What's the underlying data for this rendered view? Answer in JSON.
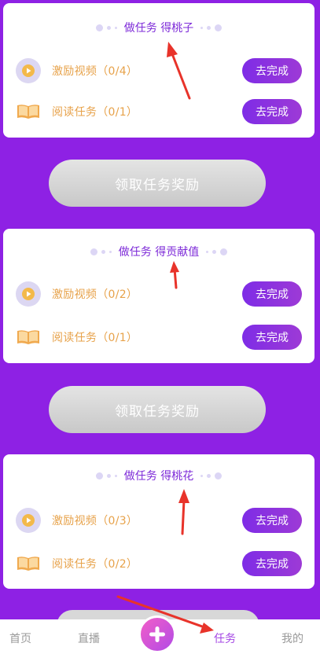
{
  "cards": [
    {
      "title": "做任务 得桃子",
      "tasks": [
        {
          "label": "激励视频（0/4）",
          "icon": "play-icon",
          "button": "去完成"
        },
        {
          "label": "阅读任务（0/1）",
          "icon": "book-icon",
          "button": "去完成"
        }
      ],
      "claim_label": "领取任务奖励"
    },
    {
      "title": "做任务 得贡献值",
      "tasks": [
        {
          "label": "激励视频（0/2）",
          "icon": "play-icon",
          "button": "去完成"
        },
        {
          "label": "阅读任务（0/1）",
          "icon": "book-icon",
          "button": "去完成"
        }
      ],
      "claim_label": "领取任务奖励"
    },
    {
      "title": "做任务 得桃花",
      "tasks": [
        {
          "label": "激励视频（0/3）",
          "icon": "play-icon",
          "button": "去完成"
        },
        {
          "label": "阅读任务（0/2）",
          "icon": "book-icon",
          "button": "去完成"
        }
      ]
    }
  ],
  "nav": {
    "home": "首页",
    "live": "直播",
    "tasks": "任务",
    "mine": "我的",
    "active": "tasks"
  },
  "colors": {
    "background": "#8e21e4",
    "accent": "#7d2ad8",
    "task_label": "#e7a24a",
    "nav_active": "#a446e4",
    "annotation_arrow": "#e8332a"
  }
}
